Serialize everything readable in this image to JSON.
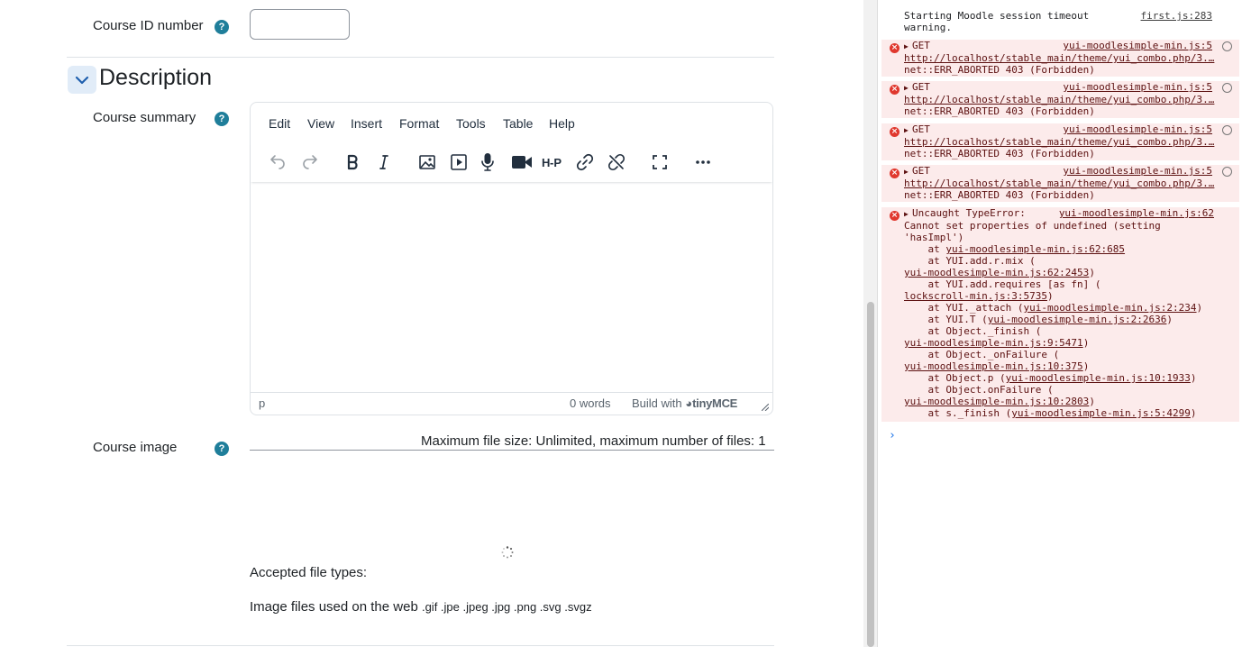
{
  "form": {
    "course_id_label": "Course ID number",
    "help_glyph": "?",
    "section_title": "Description",
    "course_summary_label": "Course summary",
    "editor": {
      "menu": [
        "Edit",
        "View",
        "Insert",
        "Format",
        "Tools",
        "Table",
        "Help"
      ],
      "toolbar_icons": [
        "undo-icon",
        "redo-icon",
        "bold-icon",
        "italic-icon",
        "image-icon",
        "media-icon",
        "microphone-icon",
        "video-camera-icon",
        "h5p-icon",
        "link-icon",
        "unlink-icon",
        "fullscreen-icon",
        "more-icon"
      ],
      "status_path": "p",
      "status_words": "0 words",
      "status_build": "Build with",
      "status_brand": "tinyMCE"
    },
    "course_image_label": "Course image",
    "max_file_size": "Maximum file size: Unlimited, maximum number of files: 1",
    "accepted_label": "Accepted file types:",
    "filetypes_label": "Image files used on the web",
    "filetypes_ext": ".gif .jpe .jpeg .jpg .png .svg .svgz"
  },
  "console": {
    "top_info": {
      "text1": "Starting Moodle session timeout",
      "text2": "warning.",
      "source": "first.js:283"
    },
    "get_errors": [
      {
        "method": "GET",
        "source": "yui-moodlesimple-min.js:5",
        "url": "http://localhost/stable_main/theme/yui_combo.php/3.…",
        "status": "net::ERR_ABORTED 403 (Forbidden)"
      },
      {
        "method": "GET",
        "source": "yui-moodlesimple-min.js:5",
        "url": "http://localhost/stable_main/theme/yui_combo.php/3.…",
        "status": "net::ERR_ABORTED 403 (Forbidden)"
      },
      {
        "method": "GET",
        "source": "yui-moodlesimple-min.js:5",
        "url": "http://localhost/stable_main/theme/yui_combo.php/3.…",
        "status": "net::ERR_ABORTED 403 (Forbidden)"
      },
      {
        "method": "GET",
        "source": "yui-moodlesimple-min.js:5",
        "url": "http://localhost/stable_main/theme/yui_combo.php/3.…",
        "status": "net::ERR_ABORTED 403 (Forbidden)"
      }
    ],
    "type_error": {
      "head": "Uncaught TypeError:",
      "source": "yui-moodlesimple-min.js:62",
      "line2": "Cannot set properties of undefined (setting",
      "line3": "'hasImpl')",
      "t1_pre": "    at ",
      "t1_link": "yui-moodlesimple-min.js:62:685",
      "t2_pre": "    at YUI.add.r.mix (",
      "t2b_link": "yui-moodlesimple-min.js:62:2453",
      "t2b_post": ")",
      "t3_pre": "    at YUI.add.requires [as fn] (",
      "t3b_link": "lockscroll-min.js:3:5735",
      "t3b_post": ")",
      "t4_pre": "    at YUI._attach (",
      "t4_link": "yui-moodlesimple-min.js:2:234",
      "t4_post": ")",
      "t5_pre": "    at YUI.T (",
      "t5_link": "yui-moodlesimple-min.js:2:2636",
      "t5_post": ")",
      "t6_pre": "    at Object._finish (",
      "t6b_link": "yui-moodlesimple-min.js:9:5471",
      "t6b_post": ")",
      "t7_pre": "    at Object._onFailure (",
      "t7b_link": "yui-moodlesimple-min.js:10:375",
      "t7b_post": ")",
      "t8_pre": "    at Object.p (",
      "t8_link": "yui-moodlesimple-min.js:10:1933",
      "t8_post": ")",
      "t9_pre": "    at Object.onFailure (",
      "t9b_link": "yui-moodlesimple-min.js:10:2803",
      "t9b_post": ")",
      "t10_pre": "    at s._finish (",
      "t10_link": "yui-moodlesimple-min.js:5:4299",
      "t10_post": ")"
    },
    "prompt": "›"
  }
}
